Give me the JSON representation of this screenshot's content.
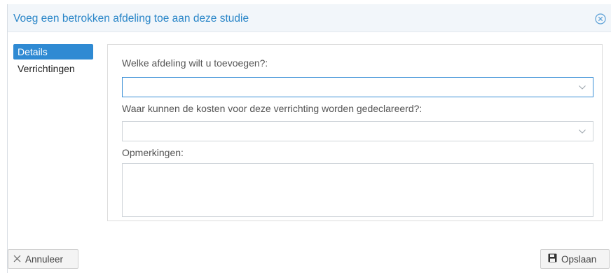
{
  "dialog": {
    "title": "Voeg een betrokken afdeling toe aan deze studie",
    "close_icon": "close-circle-icon"
  },
  "nav": {
    "items": [
      {
        "label": "Details",
        "active": true
      },
      {
        "label": "Verrichtingen",
        "active": false
      }
    ]
  },
  "form": {
    "afdeling": {
      "label": "Welke afdeling wilt u toevoegen?:",
      "value": ""
    },
    "kosten": {
      "label": "Waar kunnen de kosten voor deze verrichting worden gedeclareerd?:",
      "value": ""
    },
    "opmerkingen": {
      "label": "Opmerkingen:",
      "value": ""
    }
  },
  "footer": {
    "cancel_label": "Annuleer",
    "cancel_icon": "x-icon",
    "save_label": "Opslaan",
    "save_icon": "floppy-disk-icon"
  },
  "colors": {
    "accent": "#2f8ad3",
    "title": "#2a86c8",
    "header_bg": "#f2f6fa"
  }
}
